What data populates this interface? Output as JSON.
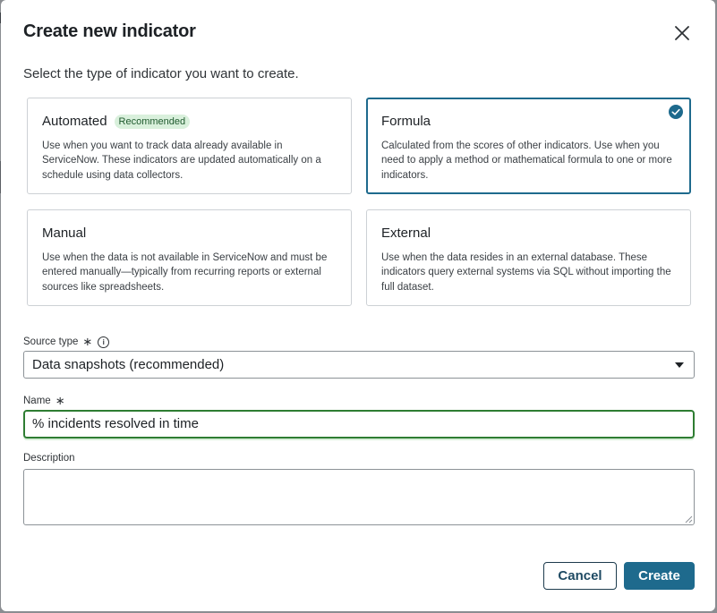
{
  "dialog": {
    "title": "Create new indicator",
    "subtitle": "Select the type of indicator you want to create."
  },
  "cards": [
    {
      "title": "Automated",
      "badge": "Recommended",
      "description": "Use when you want to track data already available in ServiceNow. These indicators are updated automatically on a schedule using data collectors.",
      "selected": false
    },
    {
      "title": "Formula",
      "description": "Calculated from the scores of other indicators. Use when you need to apply a method or mathematical formula to one or more indicators.",
      "selected": true
    },
    {
      "title": "Manual",
      "description": "Use when the data is not available in ServiceNow and must be entered manually—typically from recurring reports or external sources like spreadsheets.",
      "selected": false
    },
    {
      "title": "External",
      "description": "Use when the data resides in an external database. These indicators query external systems via SQL without importing the full dataset.",
      "selected": false
    }
  ],
  "form": {
    "source_type": {
      "label": "Source type",
      "required_mark": "∗",
      "info_icon": "info-icon",
      "value": "Data snapshots (recommended)"
    },
    "name": {
      "label": "Name",
      "required_mark": "∗",
      "value": "% incidents resolved in time"
    },
    "description": {
      "label": "Description",
      "value": ""
    }
  },
  "buttons": {
    "cancel": "Cancel",
    "create": "Create"
  },
  "colors": {
    "primary": "#1e6a8d",
    "success_border": "#2e7d32",
    "badge_bg": "#d9f0dc"
  }
}
